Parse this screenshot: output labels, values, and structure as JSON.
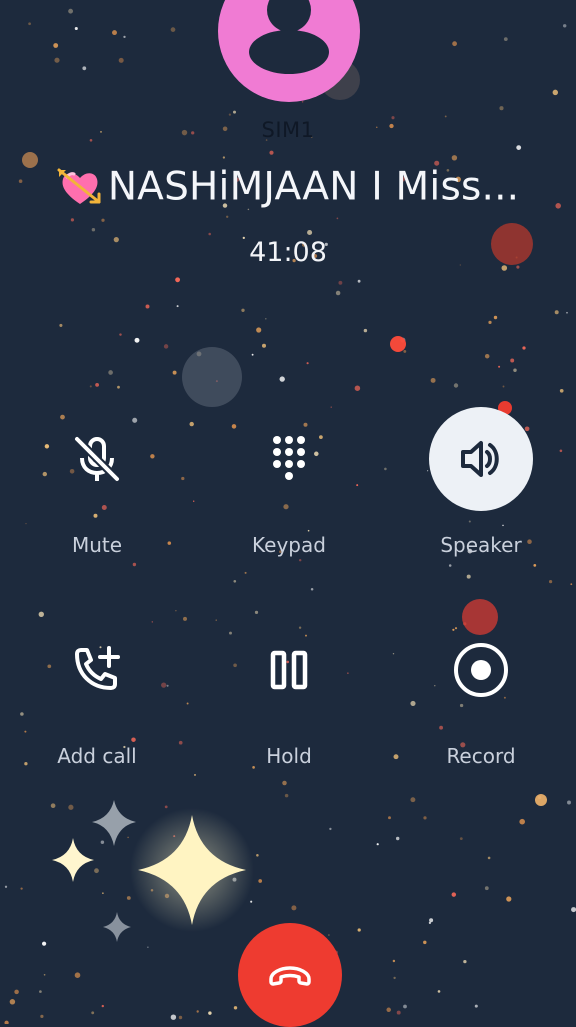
{
  "call": {
    "sim_label": "SIM1",
    "caller_emoji": "heart-with-arrow",
    "caller_name": "NASHiMJAAN I Miss...",
    "duration": "41:08"
  },
  "controls": {
    "mute": {
      "label": "Mute",
      "icon": "mic-off-icon",
      "active": false
    },
    "keypad": {
      "label": "Keypad",
      "icon": "dialpad-icon",
      "active": false
    },
    "speaker": {
      "label": "Speaker",
      "icon": "speaker-icon",
      "active": true
    },
    "add_call": {
      "label": "Add call",
      "icon": "add-call-icon",
      "active": false
    },
    "hold": {
      "label": "Hold",
      "icon": "pause-icon",
      "active": false
    },
    "record": {
      "label": "Record",
      "icon": "record-icon",
      "active": false
    }
  },
  "end_call": {
    "icon": "end-call-icon",
    "color": "#ee3b30"
  },
  "theme": {
    "background": "#1d2a3d",
    "avatar_color": "#f07bd3",
    "active_button": "#edf1f6"
  }
}
